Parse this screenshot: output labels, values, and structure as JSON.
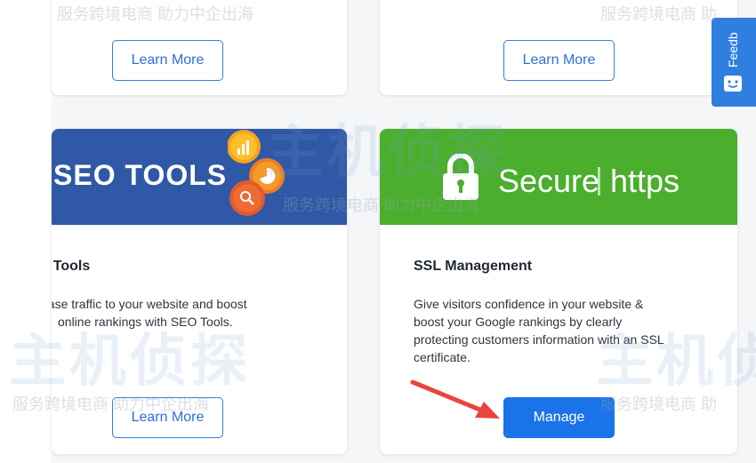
{
  "cards": {
    "top_left": {
      "button_label": "Learn More"
    },
    "top_right": {
      "button_label": "Learn More"
    },
    "seo": {
      "banner_text": "SEO TOOLS",
      "title": ") Tools",
      "description_line1": "ease traffic to your website and boost",
      "description_line2": "online rankings with SEO Tools.",
      "button_label": "Learn More"
    },
    "ssl": {
      "banner_text_secure": "Secure",
      "banner_separator": "|",
      "banner_text_https": "https",
      "title": "SSL Management",
      "description_line1": "Give visitors confidence in your website &",
      "description_line2": "boost your Google rankings by clearly",
      "description_line3": "protecting customers information with an SSL",
      "description_line4": "certificate.",
      "button_label": "Manage"
    }
  },
  "feedback": {
    "label": "Feedb"
  },
  "watermark": {
    "slogan": "服务跨境电商 助力中企出海",
    "slogan_short": "服务跨境电商 助",
    "logo": "主机侦探"
  },
  "colors": {
    "primary": "#1a73e8",
    "seo_banner": "#2f58a6",
    "ssl_banner": "#4bae2d",
    "annotation_arrow": "#e8453c"
  },
  "icons": {
    "padlock": "padlock-icon",
    "feedback": "feedback-face-icon",
    "arrow": "red-annotation-arrow"
  }
}
